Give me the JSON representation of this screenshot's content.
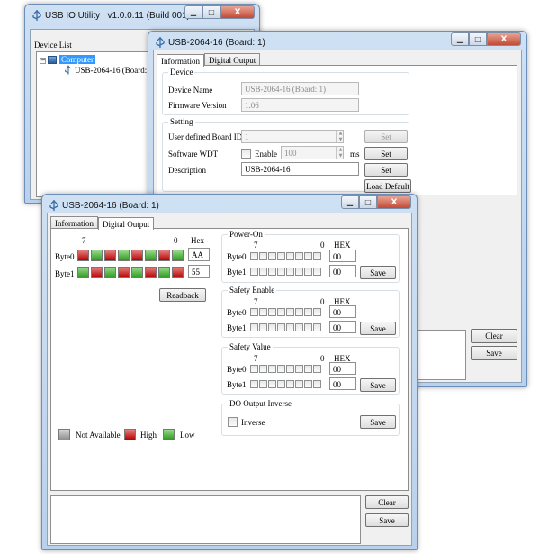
{
  "main_window": {
    "title": "USB IO Utility",
    "version": "v1.0.0.11 (Build 001)",
    "device_list_label": "Device List",
    "tree_root": "Computer",
    "tree_child": "USB-2064-16 (Board: 1)"
  },
  "info_window": {
    "title": "USB-2064-16 (Board: 1)",
    "tabs": [
      "Information",
      "Digital Output"
    ],
    "device_group": "Device",
    "device_name_label": "Device Name",
    "device_name_value": "USB-2064-16 (Board: 1)",
    "firmware_label": "Firmware Version",
    "firmware_value": "1.06",
    "setting_group": "Setting",
    "board_id_label": "User defined Board ID",
    "board_id_value": "1",
    "wdt_label": "Software WDT",
    "enable_label": "Enable",
    "wdt_value": "100",
    "ms_label": "ms",
    "description_label": "Description",
    "description_value": "USB-2064-16",
    "set_label": "Set",
    "load_default_label": "Load Default",
    "clear_label": "Clear",
    "save_label": "Save"
  },
  "do_window": {
    "title": "USB-2064-16 (Board: 1)",
    "tabs": [
      "Information",
      "Digital Output"
    ],
    "bit_high": "7",
    "bit_low": "0",
    "hex_header": "Hex",
    "byte0_label": "Byte0",
    "byte1_label": "Byte1",
    "byte0_hex": "AA",
    "byte1_hex": "55",
    "byte0_leds": [
      "red",
      "green",
      "red",
      "green",
      "red",
      "green",
      "red",
      "green"
    ],
    "byte1_leds": [
      "green",
      "red",
      "green",
      "red",
      "green",
      "red",
      "green",
      "red"
    ],
    "readback_label": "Readback",
    "legend": {
      "not_available": "Not Available",
      "high": "High",
      "low": "Low"
    },
    "power_on": {
      "title": "Power-On",
      "byte0_hex": "00",
      "byte1_hex": "00"
    },
    "safety_enable": {
      "title": "Safety Enable",
      "byte0_hex": "00",
      "byte1_hex": "00"
    },
    "safety_value": {
      "title": "Safety Value",
      "byte0_hex": "00",
      "byte1_hex": "00"
    },
    "hex_label": "HEX",
    "save_label": "Save",
    "do_inverse_title": "DO Output Inverse",
    "inverse_label": "Inverse",
    "clear_label": "Clear"
  },
  "colors": {
    "led_high": "#c00000",
    "led_low": "#2b9a1d",
    "led_na": "#9a9a9a"
  }
}
